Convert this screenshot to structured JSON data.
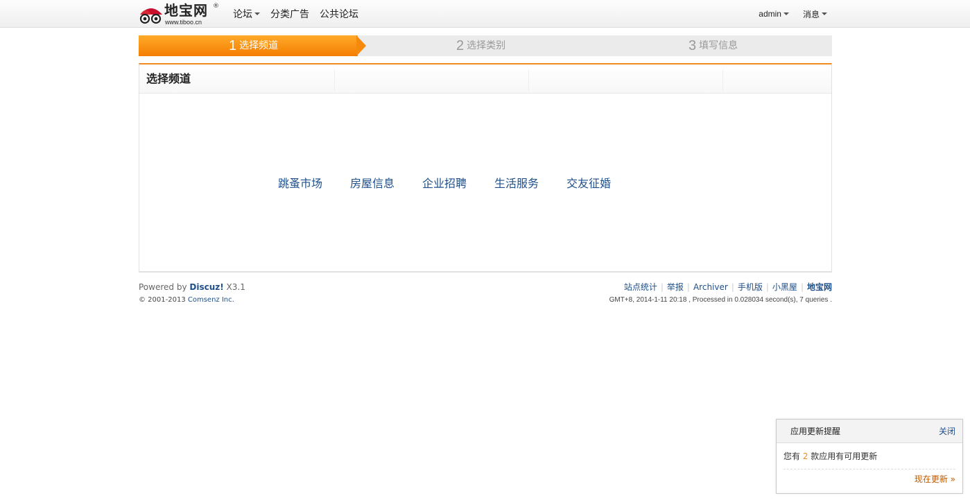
{
  "header": {
    "logo_text": "地宝网",
    "logo_reg": "®",
    "logo_url": "www.tiboo.cn",
    "nav": [
      {
        "label": "论坛",
        "has_dropdown": true
      },
      {
        "label": "分类广告",
        "has_dropdown": false
      },
      {
        "label": "公共论坛",
        "has_dropdown": false
      }
    ],
    "user": {
      "name": "admin",
      "messages": "消息"
    }
  },
  "steps": [
    {
      "num": "1",
      "label": "选择频道",
      "active": true
    },
    {
      "num": "2",
      "label": "选择类别",
      "active": false
    },
    {
      "num": "3",
      "label": "填写信息",
      "active": false
    }
  ],
  "panel": {
    "title": "选择频道",
    "channels": [
      "跳蚤市场",
      "房屋信息",
      "企业招聘",
      "生活服务",
      "交友征婚"
    ]
  },
  "footer": {
    "powered_prefix": "Powered by ",
    "powered_brand": "Discuz!",
    "powered_version": " X3.1",
    "copyright_prefix": "© 2001-2013 ",
    "copyright_company": "Comsenz Inc.",
    "links": [
      "站点统计",
      "举报",
      "Archiver",
      "手机版",
      "小黑屋",
      "地宝网"
    ],
    "meta": "GMT+8, 2014-1-11 20:18 , Processed in 0.028034 second(s), 7 queries ."
  },
  "notice": {
    "title": "应用更新提醒",
    "close": "关闭",
    "text_prefix": "您有 ",
    "count": "2",
    "text_suffix": " 款应用有可用更新",
    "action": "现在更新 »"
  },
  "colors": {
    "accent": "#f47d00",
    "link": "#1e4f8a"
  }
}
